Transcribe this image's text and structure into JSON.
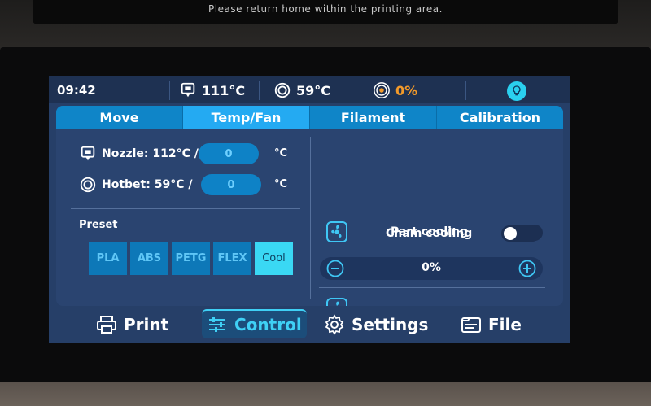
{
  "top_lcd": {
    "message": "Please return home within the printing area."
  },
  "status_bar": {
    "time": "09:42",
    "nozzle_temp": "111°C",
    "bed_temp": "59°C",
    "fan_speed": "0%"
  },
  "tabs": [
    {
      "label": "Move",
      "active": false
    },
    {
      "label": "Temp/Fan",
      "active": true
    },
    {
      "label": "Filament",
      "active": false
    },
    {
      "label": "Calibration",
      "active": false
    }
  ],
  "temperature": {
    "nozzle": {
      "label": "Nozzle: 112°C  /",
      "target": "0",
      "unit": "°C"
    },
    "hotbed": {
      "label": "Hotbet: 59°C  /",
      "target": "0",
      "unit": "°C"
    }
  },
  "preset": {
    "label": "Preset",
    "options": [
      "PLA",
      "ABS",
      "PETG",
      "FLEX",
      "Cool"
    ],
    "selected": "Cool"
  },
  "fans": {
    "part_cooling": {
      "label": "Part cooling",
      "enabled": false,
      "speed": "0%"
    },
    "chamber_cooling": {
      "label": "Cham cooling",
      "enabled": false
    }
  },
  "bottom_nav": [
    {
      "label": "Print",
      "icon": "printer-icon",
      "active": false
    },
    {
      "label": "Control",
      "icon": "sliders-icon",
      "active": true
    },
    {
      "label": "Settings",
      "icon": "gear-icon",
      "active": false
    },
    {
      "label": "File",
      "icon": "file-icon",
      "active": false
    }
  ],
  "colors": {
    "accent": "#24aaf2",
    "tab": "#0f85c8",
    "panel": "#2a4470",
    "fan_warning": "#f39a2a",
    "active_nav": "#3fd0f5"
  }
}
